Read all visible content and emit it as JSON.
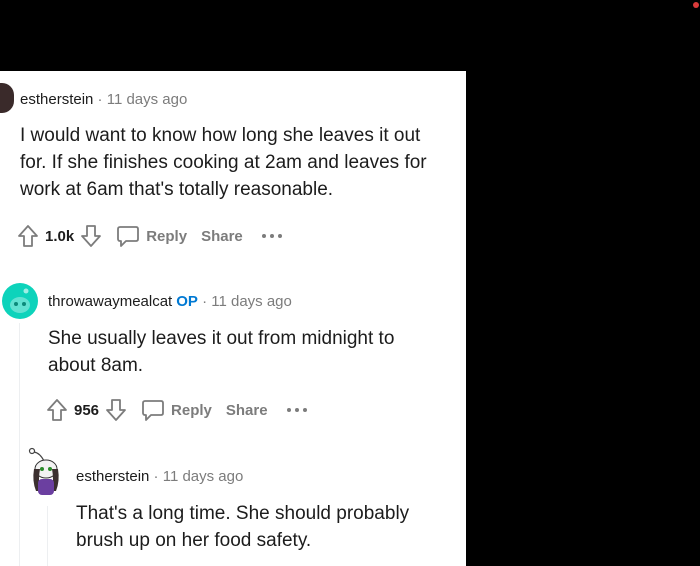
{
  "colors": {
    "accent": "#0079d3",
    "text": "#1c1c1c",
    "muted": "#7c7c7c"
  },
  "comments": [
    {
      "user": "estherstein",
      "time": "11 days ago",
      "body": [
        "I would want to know how long she leaves it out",
        "for. If she finishes cooking at 2am and leaves for",
        "work at 6am that's totally reasonable."
      ],
      "votes": "1.0k",
      "reply_label": "Reply",
      "share_label": "Share"
    },
    {
      "user": "throwawaymealcat",
      "op_badge": "OP",
      "time": "11 days ago",
      "body": [
        "She usually leaves it out from midnight to",
        "about 8am."
      ],
      "votes": "956",
      "reply_label": "Reply",
      "share_label": "Share"
    },
    {
      "user": "estherstein",
      "time": "11 days ago",
      "body": [
        "That's a long time. She should probably",
        "brush up on her food safety."
      ]
    }
  ],
  "separator": "·",
  "icons": [
    "upvote-icon",
    "downvote-icon",
    "comment-bubble-icon",
    "more-options-icon"
  ]
}
